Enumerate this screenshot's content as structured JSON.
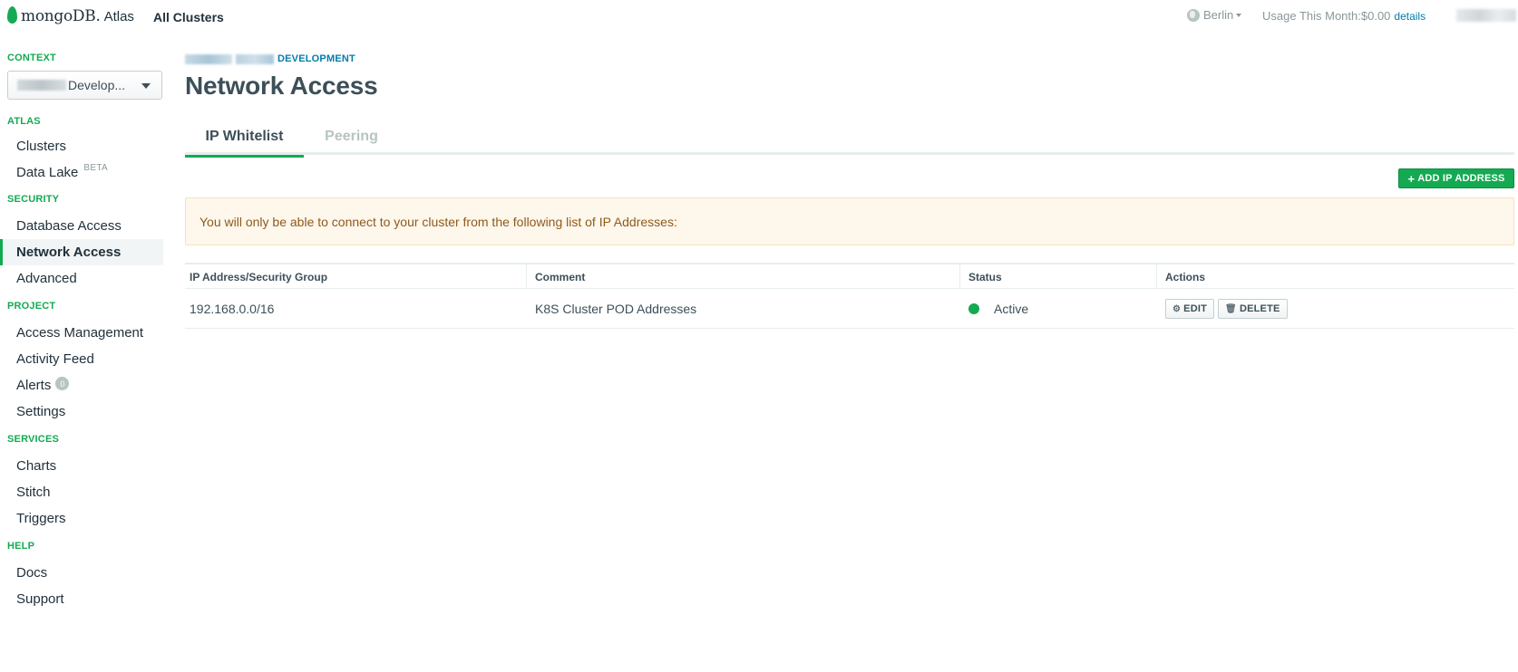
{
  "topbar": {
    "logo_text": "mongoDB.",
    "logo_product": "Atlas",
    "all_clusters": "All Clusters",
    "region": "Berlin",
    "usage_label": "Usage This Month:$0.00",
    "usage_details": "details"
  },
  "sidebar": {
    "context_label": "CONTEXT",
    "context_value": "Develop...",
    "sections": [
      {
        "label": "ATLAS",
        "items": [
          {
            "label": "Clusters"
          },
          {
            "label": "Data Lake",
            "badge": "BETA"
          }
        ]
      },
      {
        "label": "SECURITY",
        "items": [
          {
            "label": "Database Access"
          },
          {
            "label": "Network Access",
            "active": true
          },
          {
            "label": "Advanced"
          }
        ]
      },
      {
        "label": "PROJECT",
        "items": [
          {
            "label": "Access Management"
          },
          {
            "label": "Activity Feed"
          },
          {
            "label": "Alerts",
            "count": "0"
          },
          {
            "label": "Settings"
          }
        ]
      },
      {
        "label": "SERVICES",
        "items": [
          {
            "label": "Charts"
          },
          {
            "label": "Stitch"
          },
          {
            "label": "Triggers"
          }
        ]
      },
      {
        "label": "HELP",
        "items": [
          {
            "label": "Docs"
          },
          {
            "label": "Support"
          }
        ]
      }
    ]
  },
  "main": {
    "breadcrumb": "DEVELOPMENT",
    "title": "Network Access",
    "tabs": [
      {
        "label": "IP Whitelist",
        "active": true
      },
      {
        "label": "Peering",
        "active": false
      }
    ],
    "add_button": "ADD IP ADDRESS",
    "alert": "You will only be able to connect to your cluster from the following list of IP Addresses:",
    "table": {
      "headers": [
        "IP Address/Security Group",
        "Comment",
        "Status",
        "Actions"
      ],
      "rows": [
        {
          "ip": "192.168.0.0/16",
          "comment": "K8S Cluster POD Addresses",
          "status": "Active",
          "edit": "EDIT",
          "delete": "DELETE"
        }
      ]
    }
  },
  "colors": {
    "brand_green": "#13aa52",
    "link_blue": "#007cad",
    "alert_bg": "#fef7ec",
    "alert_text": "#8f5a1b"
  },
  "icons": [
    "mongodb-leaf-icon",
    "globe-icon",
    "caret-down-icon",
    "plus-icon",
    "gear-icon",
    "trash-icon",
    "status-dot-icon"
  ]
}
